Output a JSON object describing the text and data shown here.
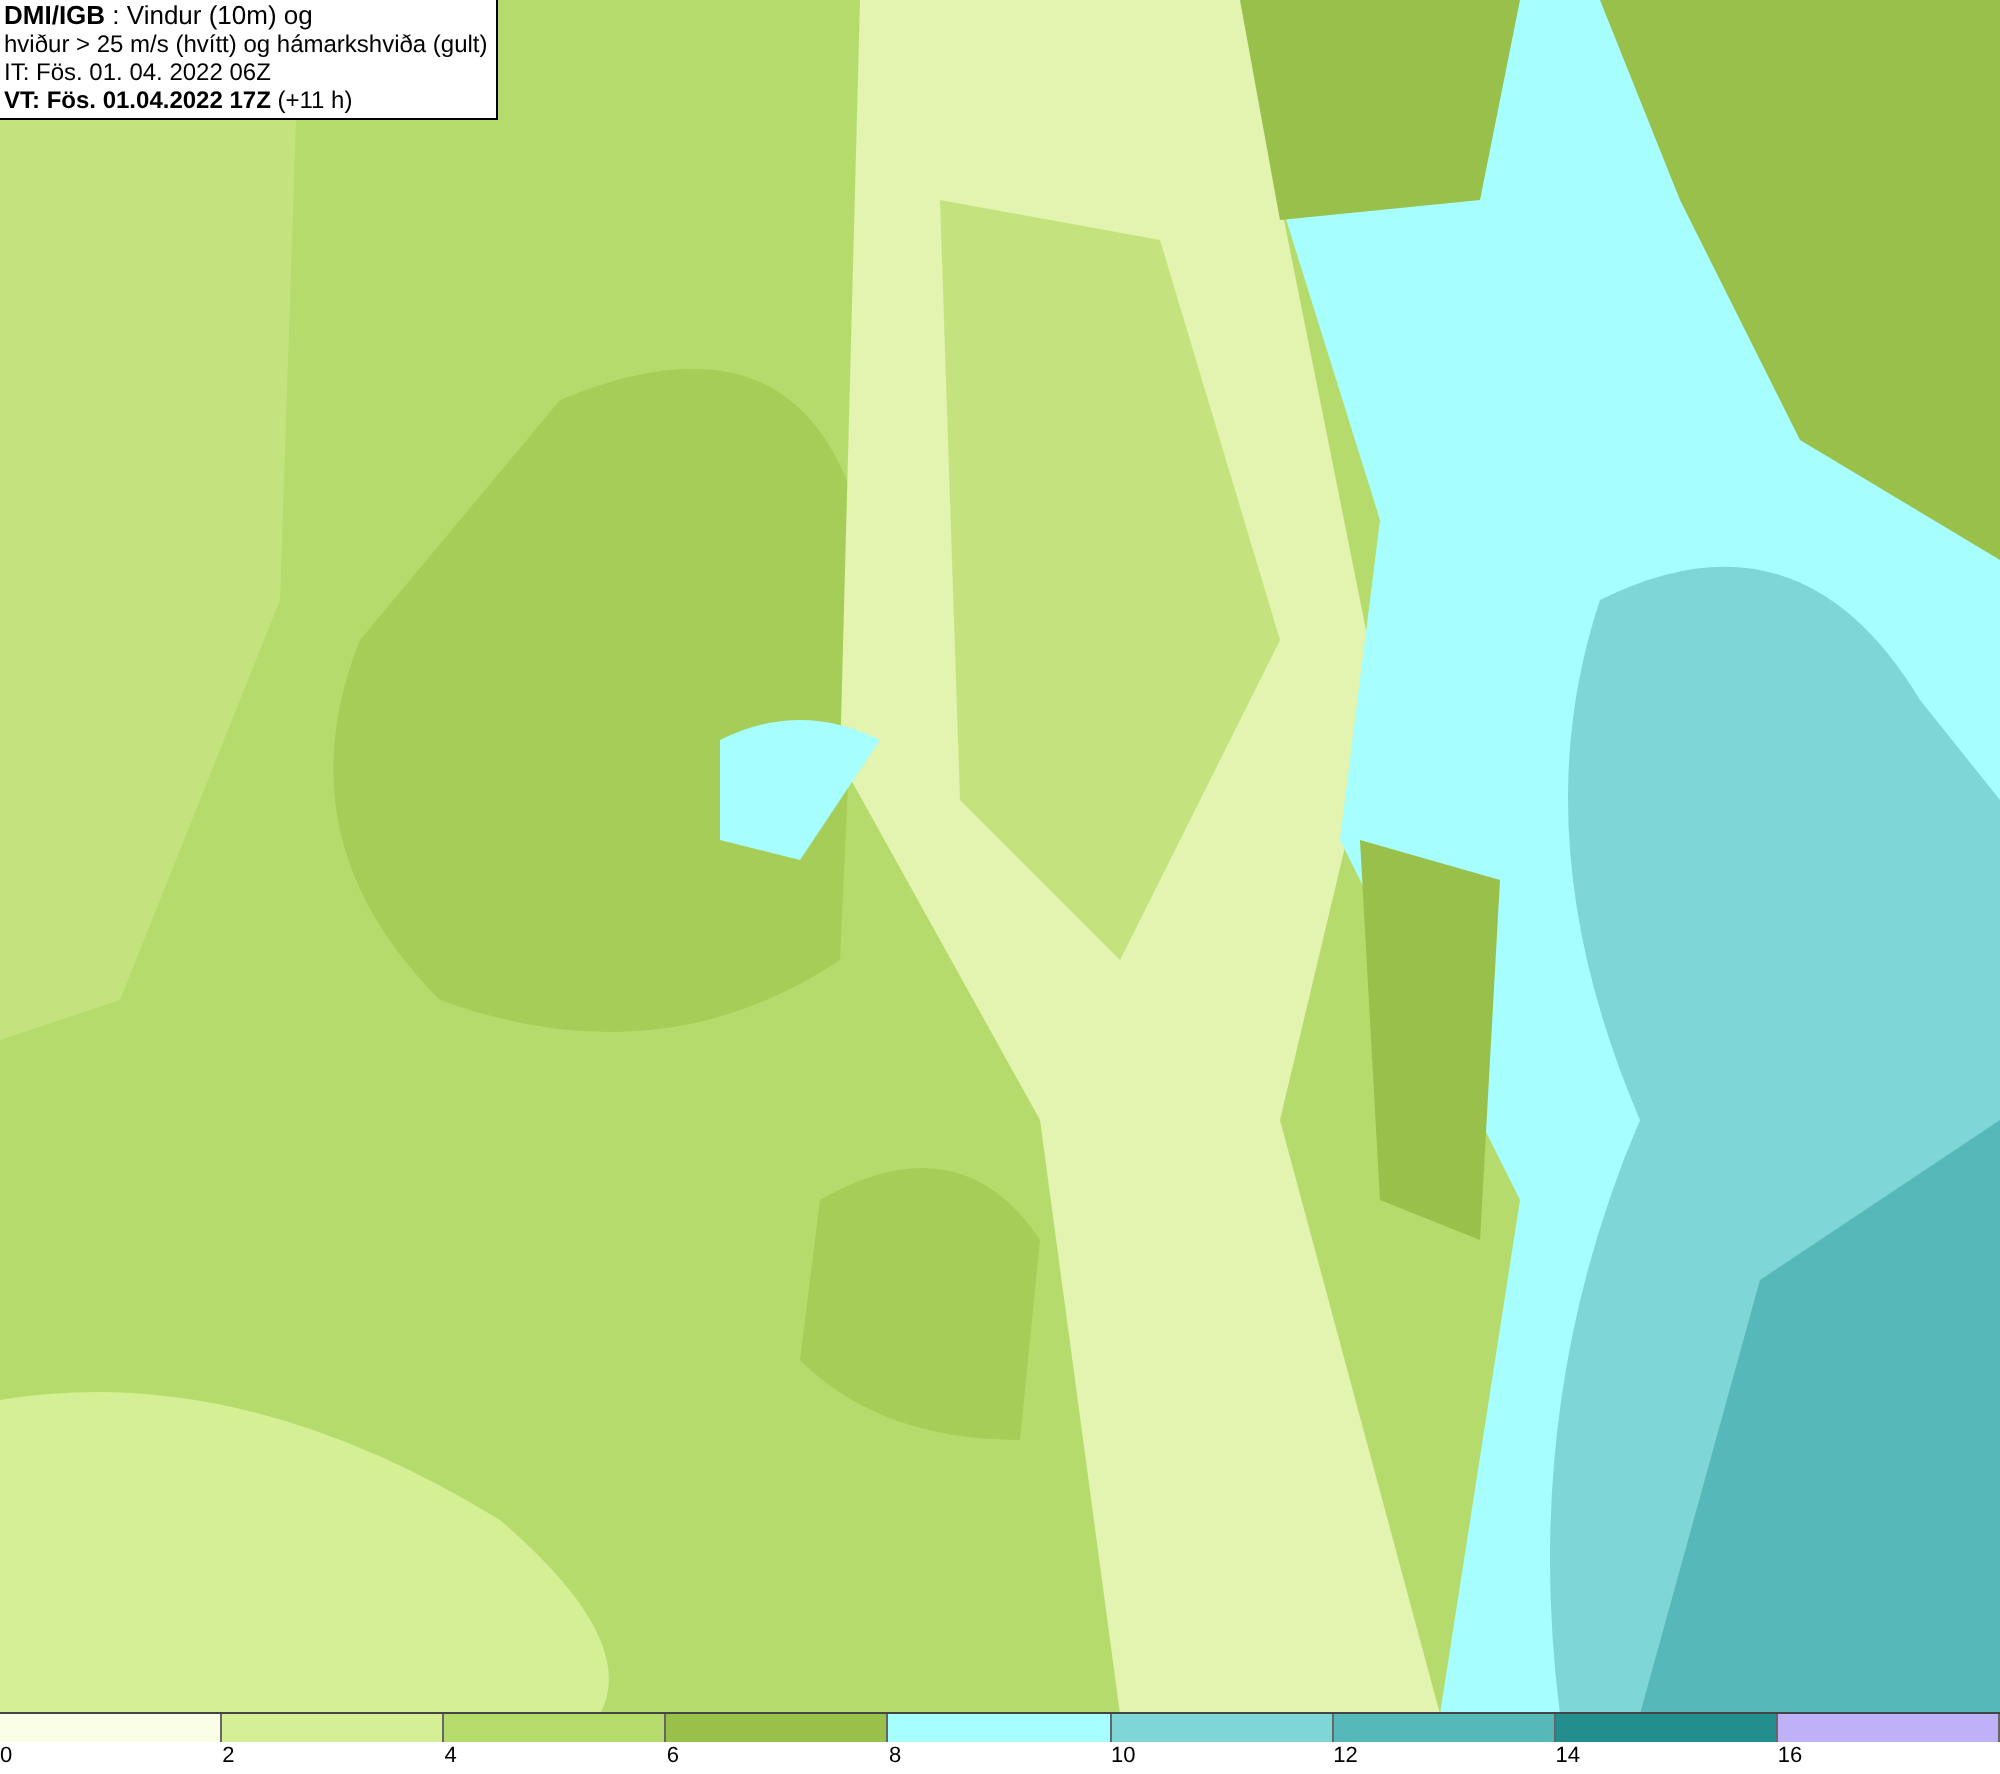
{
  "header": {
    "lines": [
      "**DMI/IGB** : Vindur (10m) og",
      "hviður > 25 m/s (hvítt) og hámarkshviða (gult)",
      "IT: Fös. 01. 04. 2022 06Z",
      "**VT: Fös. 01.04.2022 17Z** (+11 h)"
    ]
  },
  "legend": [
    {
      "label": "0",
      "color": "#fafde6"
    },
    {
      "label": "2",
      "color": "#d4ef94"
    },
    {
      "label": "4",
      "color": "#b5db6c"
    },
    {
      "label": "6",
      "color": "#98c04a"
    },
    {
      "label": "8",
      "color": "#a6fefe"
    },
    {
      "label": "10",
      "color": "#7fd6d6"
    },
    {
      "label": "12",
      "color": "#56b8b8"
    },
    {
      "label": "14",
      "color": "#228e8e"
    },
    {
      "label": "16",
      "color": "#c0b0f8"
    }
  ]
}
